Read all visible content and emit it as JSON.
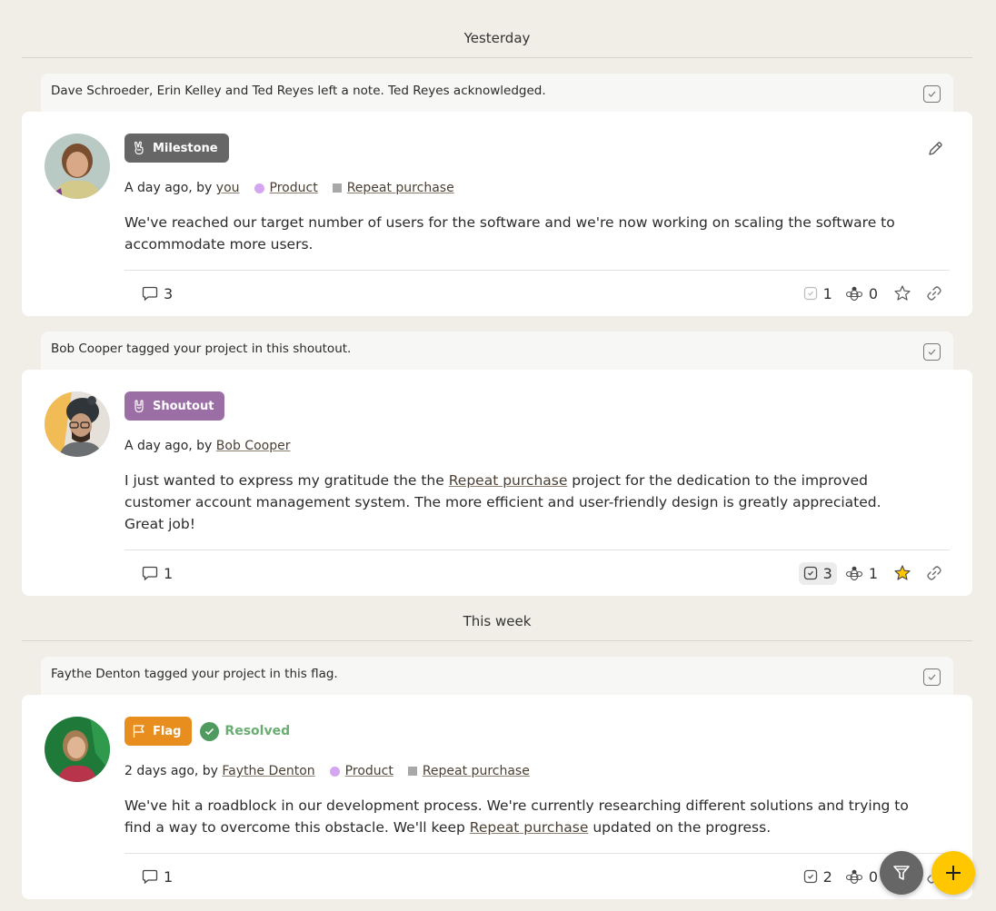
{
  "sections": [
    {
      "label": "Yesterday"
    },
    {
      "label": "This week"
    }
  ],
  "posts": [
    {
      "note": "Dave Schroeder, Erin Kelley and Ted Reyes left a note. Ted Reyes acknowledged.",
      "type_label": "Milestone",
      "type_icon": "peace-hand-icon",
      "type_color": "#666666",
      "time": "A day ago, by ",
      "author": "you",
      "tags": [
        {
          "label": "Product",
          "shape": "circle",
          "color": "#d4a6f2"
        },
        {
          "label": "Repeat purchase",
          "shape": "square",
          "color": "#a8a8a8"
        }
      ],
      "body_before": "We've reached our target number of users for the software and we're now working on scaling the software to accommodate more users.",
      "body_link": "",
      "body_after": "",
      "comments": "3",
      "acknowledgements": "1",
      "bees": "0",
      "starred": false,
      "ack_active": false,
      "editable": true
    },
    {
      "note": "Bob Cooper tagged your project in this shoutout.",
      "type_label": "Shoutout",
      "type_icon": "rock-hand-icon",
      "type_color": "#9b6fa5",
      "time": "A day ago, by ",
      "author": "Bob Cooper",
      "tags": [],
      "body_before": "I just wanted to express my gratitude the the ",
      "body_link": "Repeat purchase",
      "body_after": " project for the dedication to the improved customer account management system. The more efficient and user-friendly design is greatly appreciated. Great job!",
      "comments": "1",
      "acknowledgements": "3",
      "bees": "1",
      "starred": true,
      "ack_active": true,
      "editable": false
    },
    {
      "note": "Faythe Denton tagged your project in this flag.",
      "type_label": "Flag",
      "type_icon": "flag-icon",
      "type_color": "#e88e1f",
      "status": "Resolved",
      "time": "2 days ago, by ",
      "author": "Faythe Denton",
      "tags": [
        {
          "label": "Product",
          "shape": "circle",
          "color": "#d4a6f2"
        },
        {
          "label": "Repeat purchase",
          "shape": "square",
          "color": "#a8a8a8"
        }
      ],
      "body_before": "We've hit a roadblock in our development process. We're currently researching different solutions and trying to find a way to overcome this obstacle. We'll keep ",
      "body_link": "Repeat purchase",
      "body_after": " updated on the progress.",
      "comments": "1",
      "acknowledgements": "2",
      "bees": "0",
      "starred": false,
      "ack_active": false,
      "editable": false
    }
  ],
  "fab": {
    "filter_icon": "filter-icon",
    "add_icon": "plus-icon",
    "add_color": "#ffc700"
  }
}
